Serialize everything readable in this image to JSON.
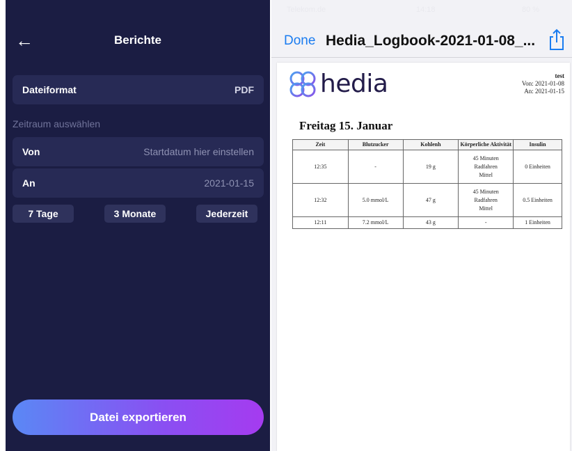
{
  "left": {
    "header": {
      "back_icon": "arrow-left-icon",
      "title": "Berichte"
    },
    "file_format": {
      "label": "Dateiformat",
      "value": "PDF"
    },
    "range_label": "Zeitraum auswählen",
    "from": {
      "label": "Von",
      "placeholder": "Startdatum hier einstellen"
    },
    "to": {
      "label": "An",
      "value": "2021-01-15"
    },
    "presets": [
      "7 Tage",
      "3 Monate",
      "Jederzeit"
    ],
    "export_label": "Datei exportieren",
    "colors": {
      "background": "#1b1d43",
      "card": "#272a55",
      "gradient_start": "#5a88f5",
      "gradient_end": "#a53bf0"
    }
  },
  "right": {
    "statusbar": {
      "carrier": "Telekom.de",
      "time": "14:18",
      "battery": "80 %"
    },
    "navbar": {
      "done_label": "Done",
      "title": "Hedia_Logbook-2021-01-08_...",
      "share_icon": "share-icon"
    },
    "document": {
      "brand": "hedia",
      "user": "test",
      "von": "Von: 2021-01-08",
      "an": "An: 2021-01-15",
      "day_title": "Freitag 15. Januar",
      "table": {
        "headers": [
          "Zeit",
          "Blutzucker",
          "Kohlenh",
          "Körperliche Aktivität",
          "Insulin"
        ],
        "rows": [
          {
            "zeit": "12:35",
            "blutzucker": "-",
            "kohlenh": "19 g",
            "aktivitaet": [
              "45 Minuten",
              "Radfahren",
              "Mittel"
            ],
            "insulin": "0 Einheiten"
          },
          {
            "zeit": "12:32",
            "blutzucker": "5.0 mmol/L",
            "kohlenh": "47 g",
            "aktivitaet": [
              "45 Minuten",
              "Radfahren",
              "Mittel"
            ],
            "insulin": "0.5 Einheiten"
          },
          {
            "zeit": "12:11",
            "blutzucker": "7.2 mmol/L",
            "kohlenh": "43 g",
            "aktivitaet": [
              "-"
            ],
            "insulin": "1 Einheiten"
          }
        ]
      }
    },
    "colors": {
      "link": "#1a7cf0",
      "logo_blue": "#4aa3f0",
      "logo_purple": "#8a52e8"
    }
  }
}
